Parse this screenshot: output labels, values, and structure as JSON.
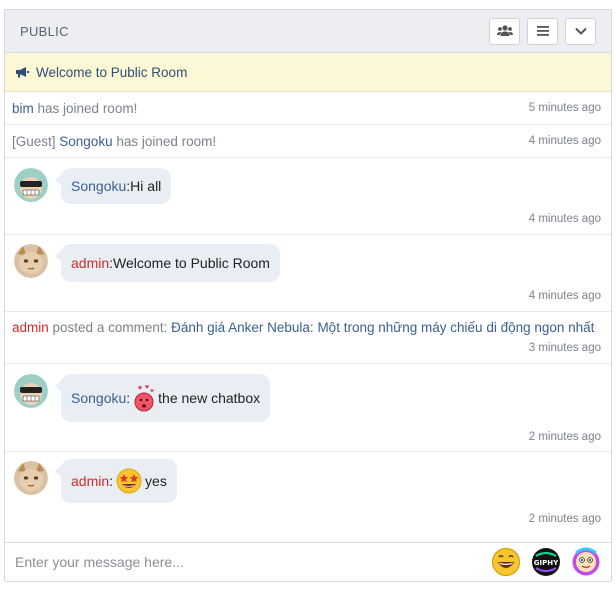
{
  "room": {
    "title": "PUBLIC"
  },
  "notice": {
    "text": "Welcome to Public Room"
  },
  "events": [
    {
      "user": "bim",
      "text": " has joined room!",
      "time": "5 minutes ago"
    },
    {
      "prefix": "[Guest] ",
      "user": "Songoku",
      "text": " has joined room!",
      "time": "4 minutes ago"
    }
  ],
  "messages": [
    {
      "user": "Songoku",
      "sep": ": ",
      "text": "Hi all",
      "time": "4 minutes ago"
    },
    {
      "user": "admin",
      "sep": ": ",
      "text": "Welcome to Public Room",
      "time": "4 minutes ago"
    },
    {
      "user": "Songoku",
      "sep": ": ",
      "text": "the new chatbox",
      "time": "2 minutes ago"
    },
    {
      "user": "admin",
      "sep": ": ",
      "text": "yes",
      "time": "2 minutes ago"
    }
  ],
  "comment": {
    "user": "admin",
    "action": " posted a comment: ",
    "title": "Đánh giá Anker Nebula: Một trong những máy chiếu di động ngon nhất",
    "time": "3 minutes ago"
  },
  "input": {
    "placeholder": "Enter your message here..."
  },
  "icons": {
    "users": "users-icon",
    "menu": "menu-icon",
    "collapse": "chevron-down-icon",
    "notice": "megaphone-icon",
    "emoji": "grinning-emoji-icon",
    "giphy": "giphy-icon",
    "sticker": "sticker-icon"
  },
  "colors": {
    "admin": "#d22b2b",
    "user": "#3b5f93",
    "notice_bg": "#fcf8d6",
    "bubble_bg": "#e8eef3"
  }
}
